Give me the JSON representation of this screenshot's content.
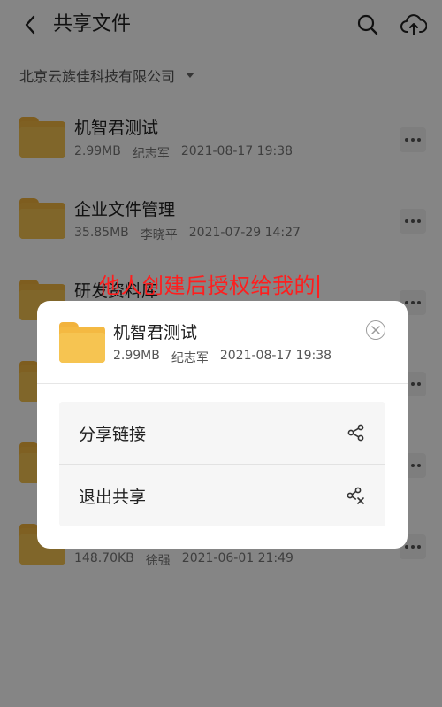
{
  "header": {
    "title": "共享文件"
  },
  "org": {
    "name": "北京云族佳科技有限公司"
  },
  "files": [
    {
      "name": "机智君测试",
      "size": "2.99MB",
      "owner": "纪志军",
      "date": "2021-08-17 19:38"
    },
    {
      "name": "企业文件管理",
      "size": "35.85MB",
      "owner": "李晓平",
      "date": "2021-07-29 14:27"
    },
    {
      "name": "研发资料库",
      "size": "",
      "owner": "",
      "date": ""
    },
    {
      "name": "",
      "size": "",
      "owner": "",
      "date": ""
    },
    {
      "name": "",
      "size": "",
      "owner": "",
      "date": ""
    },
    {
      "name": "",
      "size": "148.70KB",
      "owner": "徐强",
      "date": "2021-06-01 21:49"
    }
  ],
  "overlay_caption": "他人创建后授权给我的",
  "sheet": {
    "name": "机智君测试",
    "size": "2.99MB",
    "owner": "纪志军",
    "date": "2021-08-17 19:38",
    "actions": [
      {
        "label": "分享链接",
        "icon": "share-icon"
      },
      {
        "label": "退出共享",
        "icon": "share-exit-icon"
      }
    ]
  },
  "colors": {
    "folder": "#f4b942",
    "overlay_caption": "#ff1e1e",
    "scrim": "rgba(0,0,0,0.48)"
  }
}
